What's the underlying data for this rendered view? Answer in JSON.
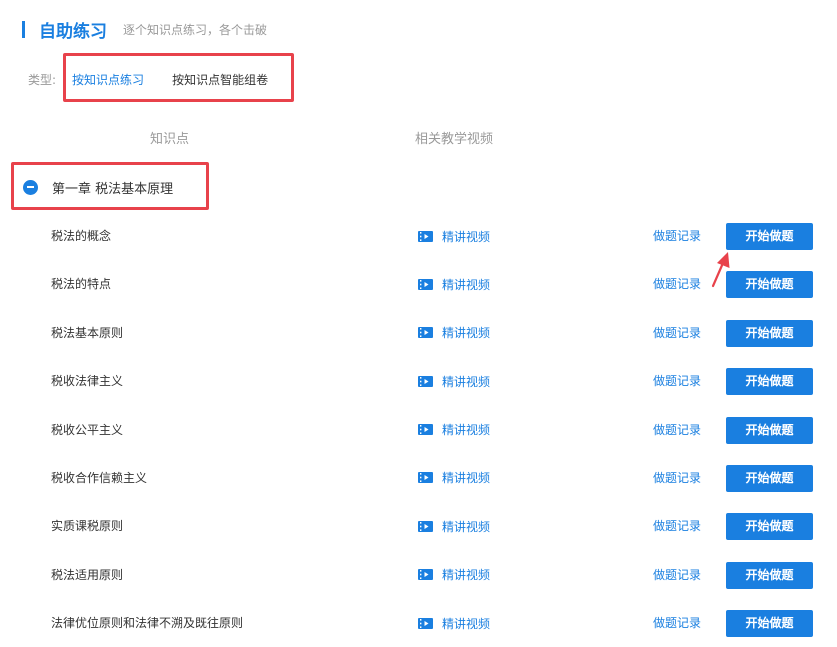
{
  "header": {
    "title": "自助练习",
    "subtitle": "逐个知识点练习，各个击破"
  },
  "type_filter": {
    "label": "类型:",
    "options": [
      {
        "label": "按知识点练习",
        "active": true
      },
      {
        "label": "按知识点智能组卷",
        "active": false
      }
    ]
  },
  "columns": {
    "knowledge_point": "知识点",
    "video": "相关教学视频"
  },
  "chapter": {
    "title": "第一章 税法基本原理"
  },
  "rows": [
    {
      "name": "税法的概念",
      "video": "精讲视频",
      "record": "做题记录",
      "action": "开始做题"
    },
    {
      "name": "税法的特点",
      "video": "精讲视频",
      "record": "做题记录",
      "action": "开始做题"
    },
    {
      "name": "税法基本原则",
      "video": "精讲视频",
      "record": "做题记录",
      "action": "开始做题"
    },
    {
      "name": "税收法律主义",
      "video": "精讲视频",
      "record": "做题记录",
      "action": "开始做题"
    },
    {
      "name": "税收公平主义",
      "video": "精讲视频",
      "record": "做题记录",
      "action": "开始做题"
    },
    {
      "name": "税收合作信赖主义",
      "video": "精讲视频",
      "record": "做题记录",
      "action": "开始做题"
    },
    {
      "name": "实质课税原则",
      "video": "精讲视频",
      "record": "做题记录",
      "action": "开始做题"
    },
    {
      "name": "税法适用原则",
      "video": "精讲视频",
      "record": "做题记录",
      "action": "开始做题"
    },
    {
      "name": "法律优位原则和法律不溯及既往原则",
      "video": "精讲视频",
      "record": "做题记录",
      "action": "开始做题"
    }
  ],
  "icons": {
    "video": "video-film-icon",
    "collapse": "minus-circle-icon",
    "annotation": "red-arrow-icon"
  },
  "colors": {
    "accent": "#1a7fe0",
    "highlight": "#e8424b",
    "muted": "#999999"
  }
}
